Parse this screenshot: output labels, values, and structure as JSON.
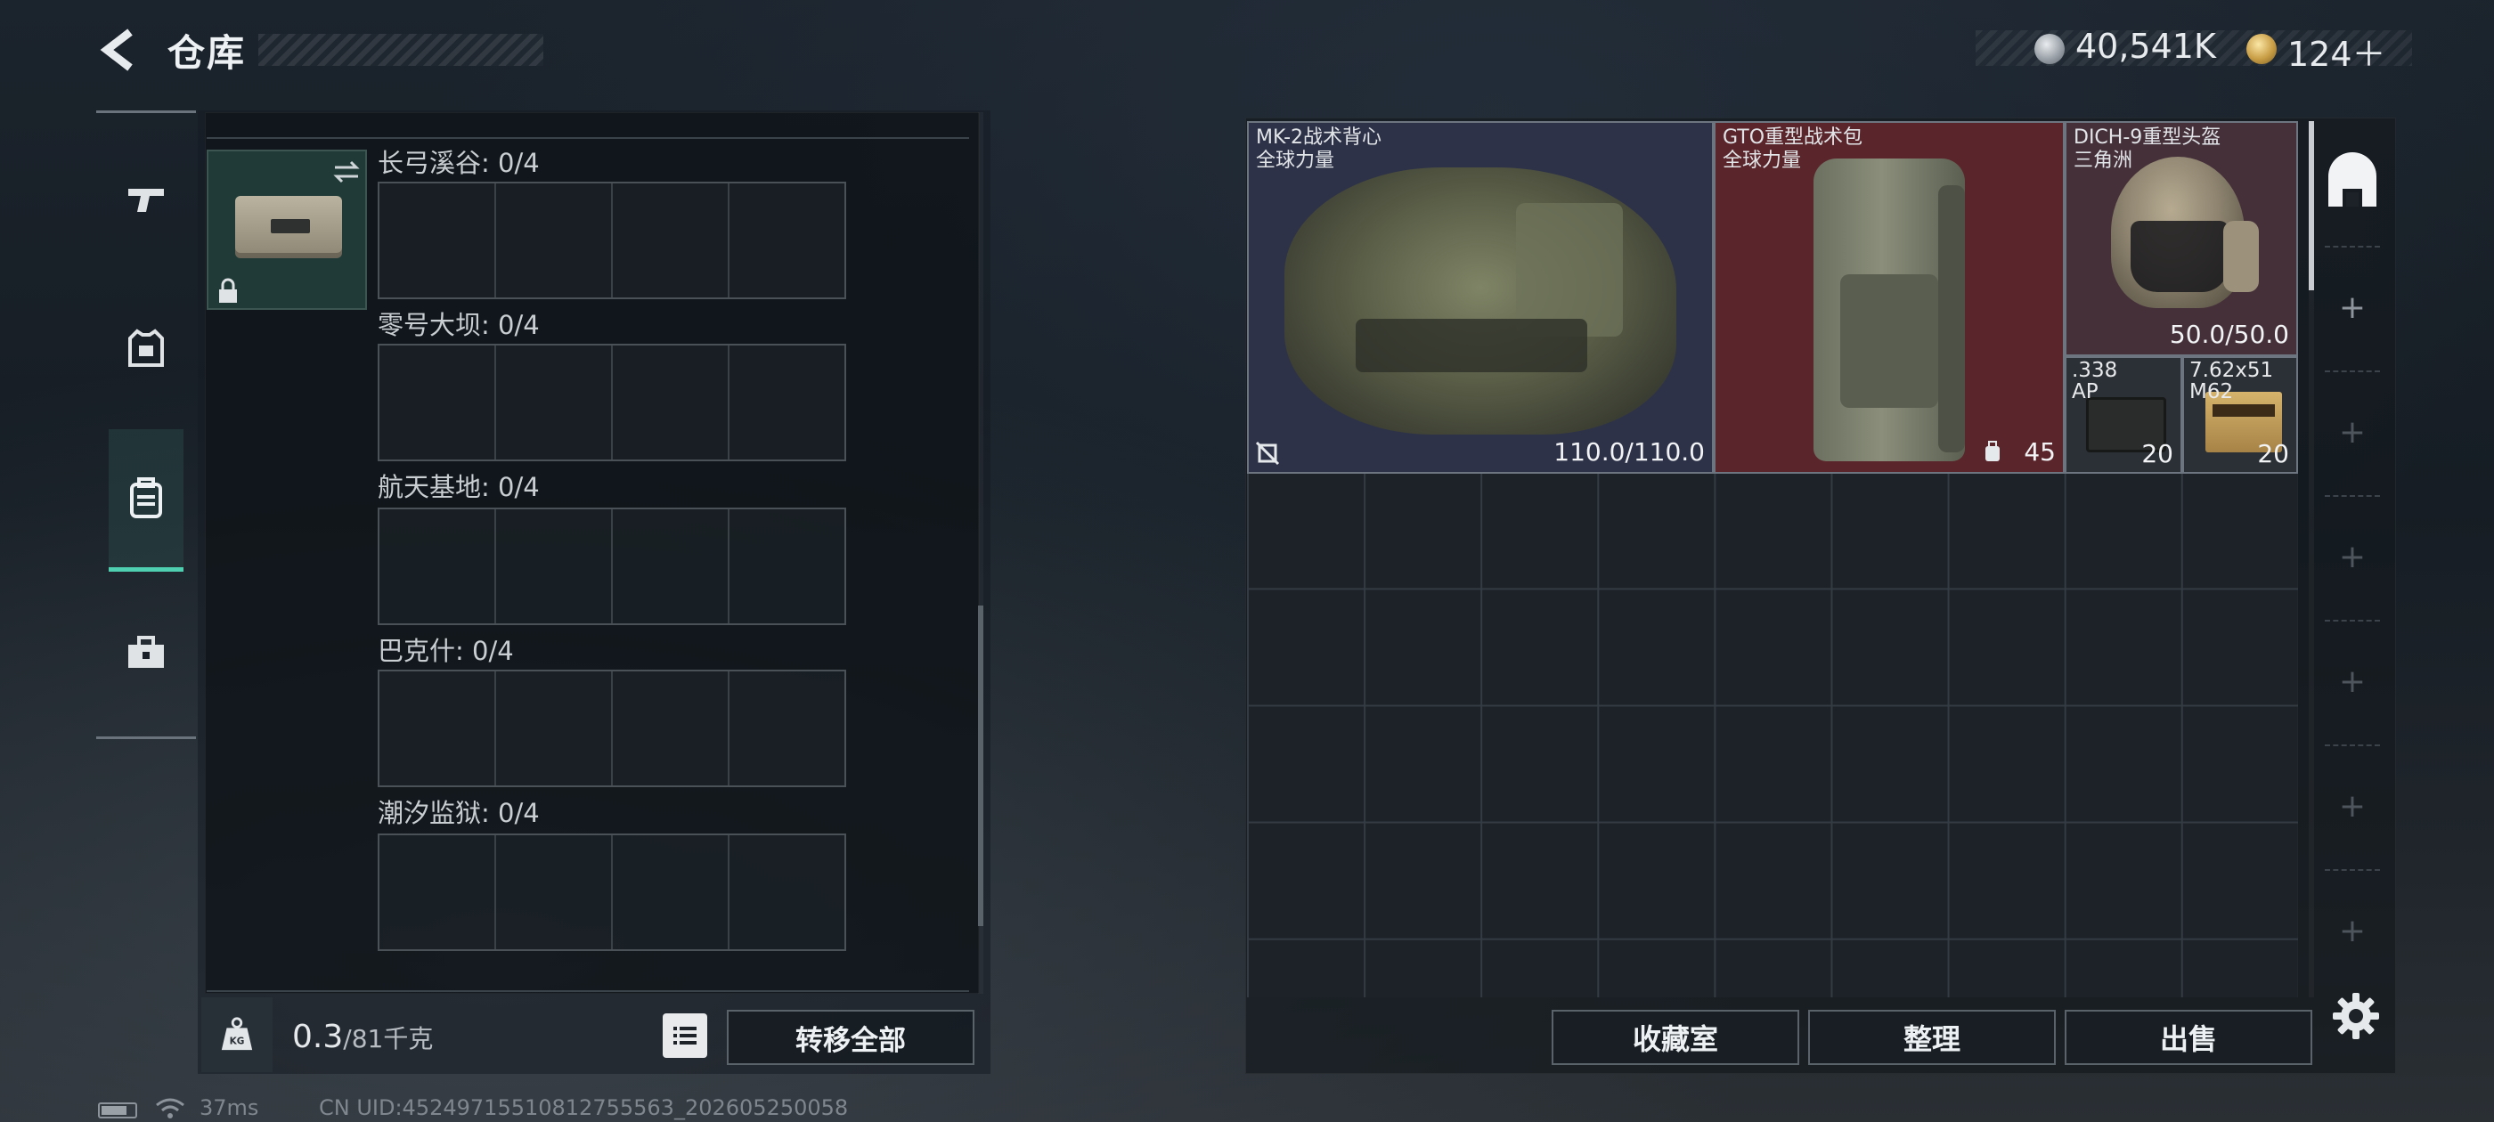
{
  "header": {
    "title": "仓库",
    "currency_silver": "40,541K",
    "currency_gold": "124＋"
  },
  "left_nav": {
    "items": [
      {
        "icon": "pistol-icon",
        "active": false
      },
      {
        "icon": "armor-icon",
        "active": false
      },
      {
        "icon": "backpack-icon",
        "active": true
      },
      {
        "icon": "toolbox-icon",
        "active": false
      }
    ]
  },
  "left_panel": {
    "maps": [
      {
        "label": "长弓溪谷: 0/4"
      },
      {
        "label": "零号大坝: 0/4"
      },
      {
        "label": "航天基地: 0/4"
      },
      {
        "label": "巴克什: 0/4"
      },
      {
        "label": "潮汐监狱: 0/4"
      }
    ],
    "weight_value": "0.3",
    "weight_unit": "/81千克",
    "transfer_all": "转移全部"
  },
  "stash": {
    "items": [
      {
        "name_line1": "MK-2战术背心",
        "name_line2": "全球力量",
        "value": "110.0/110.0",
        "color": "#2d3248"
      },
      {
        "name_line1": "GTO重型战术包",
        "name_line2": "全球力量",
        "value": "45",
        "color": "#5a262c"
      },
      {
        "name_line1": "DICH-9重型头盔",
        "name_line2": "三角洲",
        "value": "50.0/50.0",
        "color": "#45303a"
      },
      {
        "name_line1": ".338",
        "name_line2": "AP",
        "value": "20"
      },
      {
        "name_line1": "7.62x51",
        "name_line2": "M62",
        "value": "20"
      }
    ]
  },
  "actions": {
    "collection": "收藏室",
    "organize": "整理",
    "sell": "出售"
  },
  "status": {
    "ping": "37ms",
    "uid": "CN UID:4524971551081275556‌3_202605250058"
  }
}
